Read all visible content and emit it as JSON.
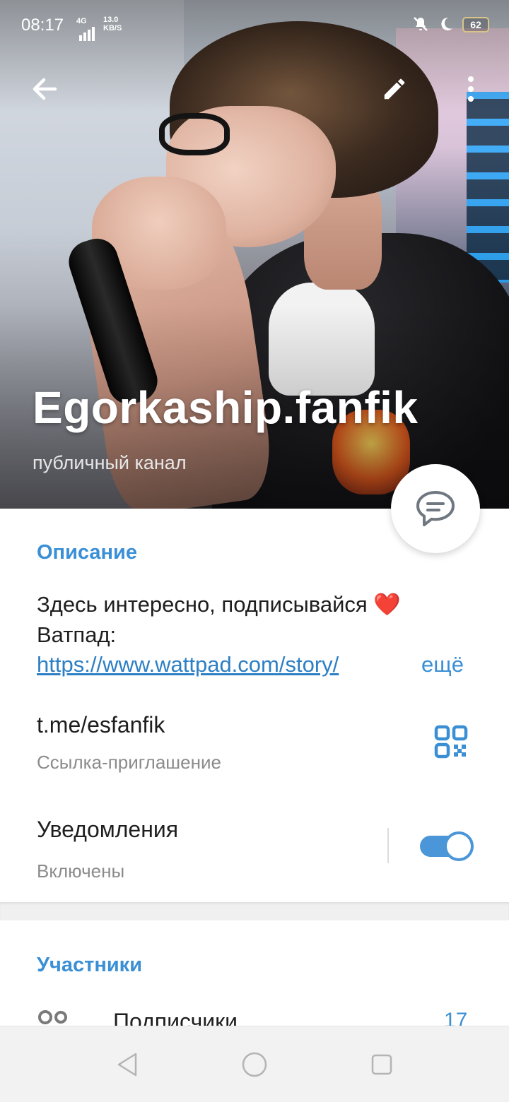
{
  "status_bar": {
    "time": "08:17",
    "network": "4G",
    "speed_value": "13.0",
    "speed_unit": "KB/S",
    "battery": "62",
    "icons": [
      "mute-icon",
      "moon-icon",
      "battery-icon"
    ]
  },
  "toolbar": {
    "back_icon": "arrow-left-icon",
    "edit_icon": "pencil-icon",
    "more_icon": "more-vertical-icon"
  },
  "channel": {
    "title": "Egorkaship.fanfik",
    "subtitle": "публичный канал"
  },
  "fab": {
    "icon": "chat-bubble-icon"
  },
  "description": {
    "heading": "Описание",
    "line1": "Здесь интересно, подписывайся",
    "heart": "❤️",
    "line2": "Ватпад:",
    "link": "https://www.wattpad.com/story/",
    "more": "ещё"
  },
  "invite": {
    "value": "t.me/esfanfik",
    "label": "Ссылка-приглашение",
    "icon": "qr-code-icon"
  },
  "notifications": {
    "title": "Уведомления",
    "status": "Включены",
    "enabled": true
  },
  "members": {
    "heading": "Участники",
    "label": "Подписчики",
    "count": "17",
    "icon": "users-icon"
  },
  "colors": {
    "accent": "#3a8fd5",
    "toggle": "#4a96d8",
    "heart": "#e11d2a"
  }
}
